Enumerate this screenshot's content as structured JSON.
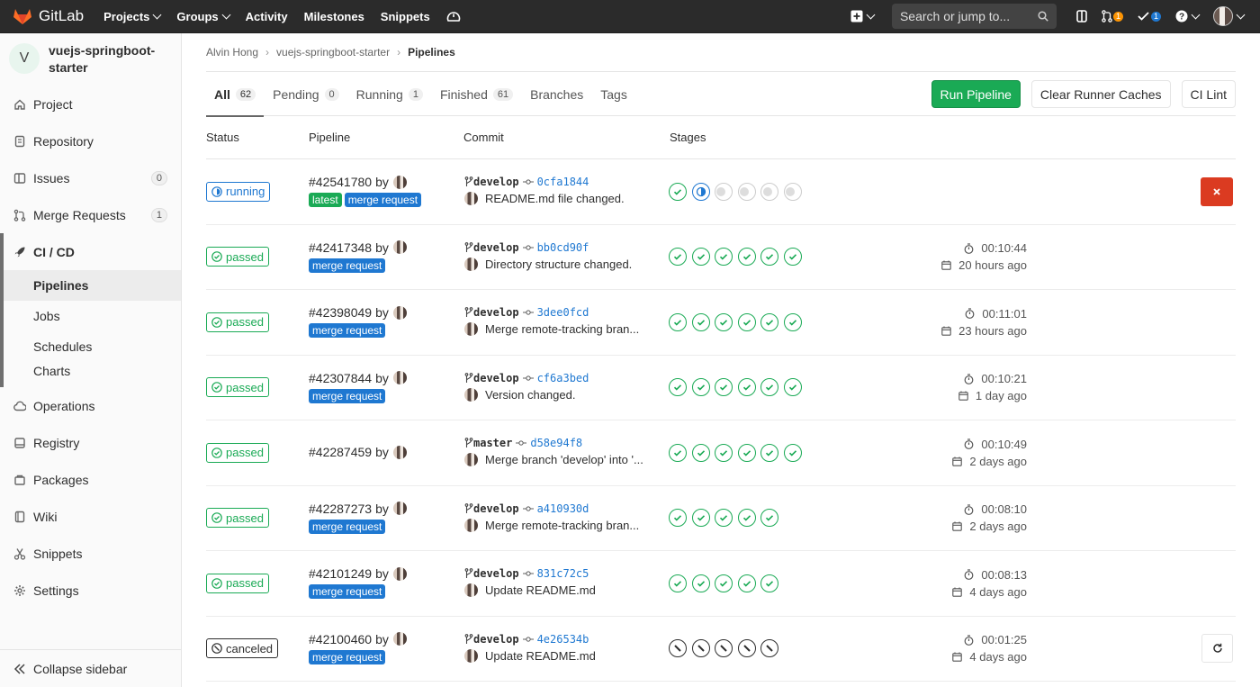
{
  "topbar": {
    "brand": "GitLab",
    "nav": [
      "Projects",
      "Groups",
      "Activity",
      "Milestones",
      "Snippets"
    ],
    "search_placeholder": "Search or jump to...",
    "mr_count": "1",
    "todo_count": "1",
    "brand_color": "#fc6d26"
  },
  "sidebar": {
    "project_initial": "V",
    "project_name": "vuejs-springboot-starter",
    "items": [
      {
        "label": "Project",
        "icon": "home-icon"
      },
      {
        "label": "Repository",
        "icon": "doc-icon"
      },
      {
        "label": "Issues",
        "icon": "issues-icon",
        "count": "0"
      },
      {
        "label": "Merge Requests",
        "icon": "merge-request-icon",
        "count": "1"
      },
      {
        "label": "CI / CD",
        "icon": "rocket-icon"
      }
    ],
    "cicd_sub": [
      "Pipelines",
      "Jobs",
      "Schedules",
      "Charts"
    ],
    "items_after": [
      {
        "label": "Operations",
        "icon": "cloud-icon"
      },
      {
        "label": "Registry",
        "icon": "disk-icon"
      },
      {
        "label": "Packages",
        "icon": "package-icon"
      },
      {
        "label": "Wiki",
        "icon": "book-icon"
      },
      {
        "label": "Snippets",
        "icon": "scissors-icon"
      },
      {
        "label": "Settings",
        "icon": "gear-icon"
      }
    ],
    "collapse_label": "Collapse sidebar"
  },
  "breadcrumb": [
    "Alvin Hong",
    "vuejs-springboot-starter",
    "Pipelines"
  ],
  "tabs": [
    {
      "label": "All",
      "count": "62"
    },
    {
      "label": "Pending",
      "count": "0"
    },
    {
      "label": "Running",
      "count": "1"
    },
    {
      "label": "Finished",
      "count": "61"
    },
    {
      "label": "Branches"
    },
    {
      "label": "Tags"
    }
  ],
  "buttons": {
    "run": "Run Pipeline",
    "clear": "Clear Runner Caches",
    "lint": "CI Lint"
  },
  "columns": [
    "Status",
    "Pipeline",
    "Commit",
    "Stages"
  ],
  "pipelines": [
    {
      "status": "running",
      "id": "#42541780",
      "by": "by",
      "labels": [
        "latest",
        "merge request"
      ],
      "branch": "develop",
      "sha": "0cfa1844",
      "message": "README.md file changed.",
      "stages": [
        "passed",
        "running",
        "pending",
        "pending",
        "pending",
        "pending"
      ],
      "duration": "",
      "finished": "",
      "action": "cancel"
    },
    {
      "status": "passed",
      "id": "#42417348",
      "by": "by",
      "labels": [
        "merge request"
      ],
      "branch": "develop",
      "sha": "bb0cd90f",
      "message": "Directory structure changed.",
      "stages": [
        "passed",
        "passed",
        "passed",
        "passed",
        "passed",
        "passed"
      ],
      "duration": "00:10:44",
      "finished": "20 hours ago",
      "action": ""
    },
    {
      "status": "passed",
      "id": "#42398049",
      "by": "by",
      "labels": [
        "merge request"
      ],
      "branch": "develop",
      "sha": "3dee0fcd",
      "message": "Merge remote-tracking bran...",
      "stages": [
        "passed",
        "passed",
        "passed",
        "passed",
        "passed",
        "passed"
      ],
      "duration": "00:11:01",
      "finished": "23 hours ago",
      "action": ""
    },
    {
      "status": "passed",
      "id": "#42307844",
      "by": "by",
      "labels": [
        "merge request"
      ],
      "branch": "develop",
      "sha": "cf6a3bed",
      "message": "Version changed.",
      "stages": [
        "passed",
        "passed",
        "passed",
        "passed",
        "passed",
        "passed"
      ],
      "duration": "00:10:21",
      "finished": "1 day ago",
      "action": ""
    },
    {
      "status": "passed",
      "id": "#42287459",
      "by": "by",
      "labels": [],
      "branch": "master",
      "sha": "d58e94f8",
      "message": "Merge branch 'develop' into '...",
      "stages": [
        "passed",
        "passed",
        "passed",
        "passed",
        "passed",
        "passed"
      ],
      "duration": "00:10:49",
      "finished": "2 days ago",
      "action": ""
    },
    {
      "status": "passed",
      "id": "#42287273",
      "by": "by",
      "labels": [
        "merge request"
      ],
      "branch": "develop",
      "sha": "a410930d",
      "message": "Merge remote-tracking bran...",
      "stages": [
        "passed",
        "passed",
        "passed",
        "passed",
        "passed"
      ],
      "duration": "00:08:10",
      "finished": "2 days ago",
      "action": ""
    },
    {
      "status": "passed",
      "id": "#42101249",
      "by": "by",
      "labels": [
        "merge request"
      ],
      "branch": "develop",
      "sha": "831c72c5",
      "message": "Update README.md",
      "stages": [
        "passed",
        "passed",
        "passed",
        "passed",
        "passed"
      ],
      "duration": "00:08:13",
      "finished": "4 days ago",
      "action": ""
    },
    {
      "status": "canceled",
      "id": "#42100460",
      "by": "by",
      "labels": [
        "merge request"
      ],
      "branch": "develop",
      "sha": "4e26534b",
      "message": "Update README.md",
      "stages": [
        "canceled",
        "canceled",
        "canceled",
        "canceled",
        "canceled"
      ],
      "duration": "00:01:25",
      "finished": "4 days ago",
      "action": "retry"
    }
  ],
  "colors": {
    "passed": "#1aaa55",
    "running": "#1f78d1",
    "canceled": "#2e2e2e",
    "danger": "#db3b21"
  }
}
